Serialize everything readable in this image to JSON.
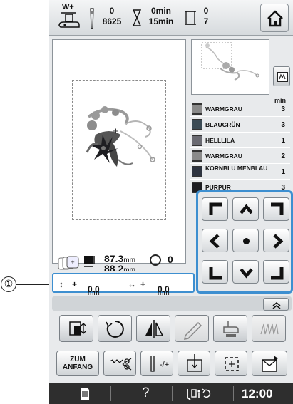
{
  "callout": {
    "label": "①"
  },
  "topbar": {
    "presser_foot_label": "W+",
    "stitch_counter": {
      "current": "0",
      "total": "8625"
    },
    "time_counter": {
      "current": "0min",
      "total": "15min"
    },
    "color_counter": {
      "current": "0",
      "total": "7"
    },
    "icons": [
      "presser-foot-icon",
      "needle-icon",
      "hourglass-icon",
      "spool-icon",
      "home-icon"
    ]
  },
  "thread_list": {
    "min_header": "min",
    "rows": [
      {
        "name": "WARMGRAU",
        "minutes": "3",
        "color": "#8a8a8a"
      },
      {
        "name": "BLAUGRÜN",
        "minutes": "3",
        "color": "#3b4b55"
      },
      {
        "name": "HELLLILA",
        "minutes": "1",
        "color": "#6a6a72"
      },
      {
        "name": "WARMGRAU",
        "minutes": "2",
        "color": "#8a8a8a"
      },
      {
        "name": "KORNBLU MENBLAU",
        "minutes": "1",
        "color": "#2e3440"
      },
      {
        "name": "PURPUR",
        "minutes": "3",
        "color": "#1e1e22"
      }
    ]
  },
  "size_info": {
    "width": "87.3",
    "height": "88.2",
    "unit": "mm",
    "rotation": "0"
  },
  "offset": {
    "vertical_sign": "+",
    "vertical_value": "0.0",
    "horizontal_sign": "+",
    "horizontal_value": "0.0",
    "unit": "mm"
  },
  "arrow_pad": [
    "up-left",
    "up",
    "up-right",
    "left",
    "center",
    "right",
    "down-left",
    "down",
    "down-right"
  ],
  "function_row": {
    "zum_anfang": "ZUM ANFANG"
  },
  "bottombar": {
    "help": "?",
    "clock": "12:00"
  }
}
